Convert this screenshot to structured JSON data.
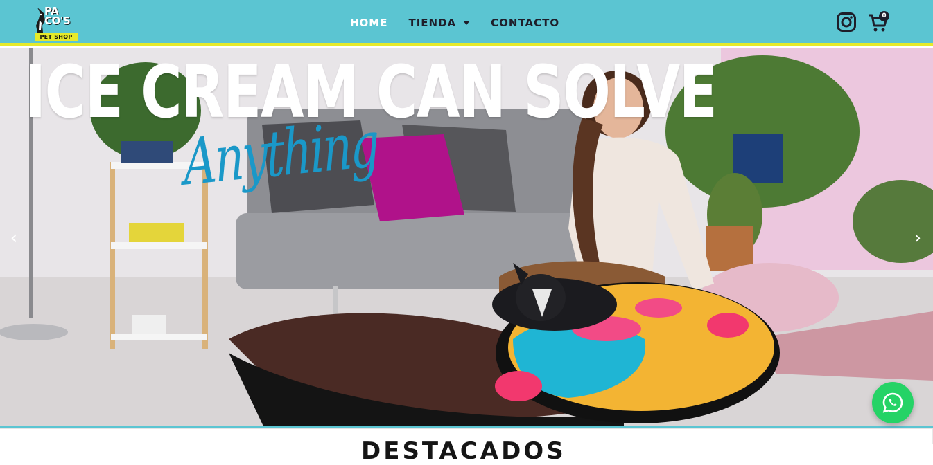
{
  "header": {
    "logo_line1": "PA",
    "logo_line2": "CO'S",
    "logo_sub": "PET SHOP",
    "nav": [
      {
        "label": "HOME",
        "active": true
      },
      {
        "label": "TIENDA",
        "has_dropdown": true
      },
      {
        "label": "CONTACTO"
      }
    ],
    "cart_count": "0",
    "icons": [
      "instagram-icon",
      "cart-icon"
    ]
  },
  "hero": {
    "headline": "ICE CREAM CAN SOLVE",
    "script": "Anything",
    "prev_arrow": "‹",
    "next_arrow": "›"
  },
  "section": {
    "title": "DESTACADOS"
  },
  "colors": {
    "header_bg": "#5bc5d2",
    "accent_yellow": "#e6ea2a",
    "script_blue": "#1a98c8",
    "whatsapp_green": "#25d366"
  }
}
